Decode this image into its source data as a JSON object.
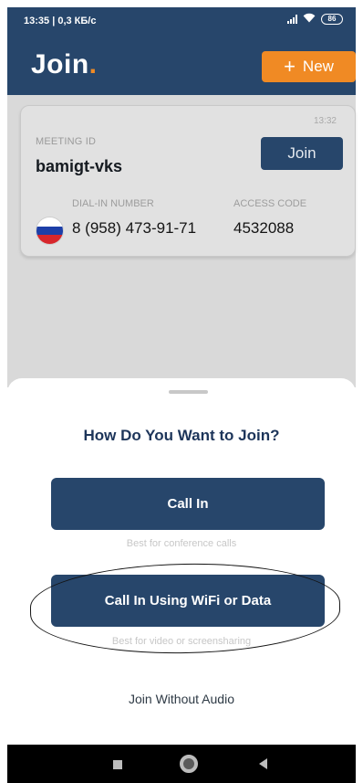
{
  "status_bar": {
    "time_speed": "13:35 | 0,3 КБ/с",
    "battery": "86"
  },
  "header": {
    "title": "Join",
    "title_dot": ".",
    "new_button_icon": "plus-icon",
    "new_button_label": "New"
  },
  "meeting_card": {
    "time": "13:32",
    "meeting_id_label": "MEETING ID",
    "meeting_id": "bamigt-vks",
    "join_button_label": "Join",
    "dial_in_label": "DIAL-IN NUMBER",
    "dial_in_number": "8 (958) 473-91-71",
    "access_code_label": "ACCESS CODE",
    "access_code": "4532088",
    "flag_icon": "russia-flag-icon"
  },
  "join_sheet": {
    "title": "How Do You Want to Join?",
    "call_in_label": "Call In",
    "call_in_caption": "Best for conference calls",
    "wifi_label": "Call In Using WiFi or Data",
    "wifi_caption": "Best for video or screensharing",
    "without_audio_label": "Join Without Audio"
  },
  "colors": {
    "navy": "#27466b",
    "accent_orange": "#f08a24",
    "dim_gray": "#d9d9d9"
  }
}
